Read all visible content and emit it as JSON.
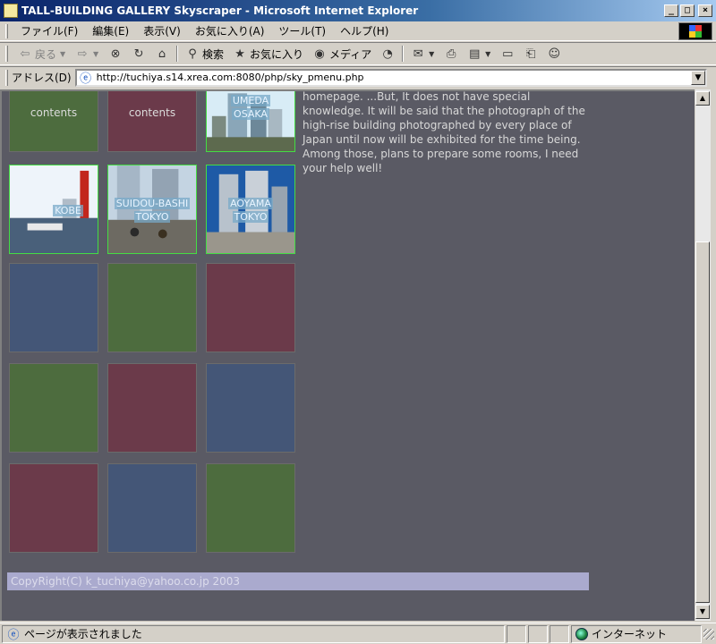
{
  "window": {
    "title": "TALL-BUILDING GALLERY Skyscraper - Microsoft Internet Explorer",
    "buttons": {
      "minimize": "_",
      "maximize": "□",
      "close": "×"
    }
  },
  "menubar": {
    "items": [
      "ファイル(F)",
      "編集(E)",
      "表示(V)",
      "お気に入り(A)",
      "ツール(T)",
      "ヘルプ(H)"
    ]
  },
  "toolbar": {
    "back": "戻る",
    "search": "検索",
    "favorites": "お気に入り",
    "media": "メディア"
  },
  "address": {
    "label": "アドレス(D)",
    "url": "http://tuchiya.s14.xrea.com:8080/php/sky_pmenu.php"
  },
  "page": {
    "tiles_row1": [
      "contents",
      "contents"
    ],
    "photos": [
      {
        "line1": "UMEDA",
        "line2": "OSAKA"
      },
      {
        "line1": "KOBE",
        "line2": ""
      },
      {
        "line1": "SUIDOU-BASHI",
        "line2": "TOKYO"
      },
      {
        "line1": "AOYAMA",
        "line2": "TOKYO"
      }
    ],
    "intro": "homepage. ...But, It does not have special knowledge. It will be said that the photograph of the high-rise building photographed by every place of Japan until now will be exhibited for the time being. Among those, plans to prepare some rooms, I need your help well!",
    "footer": "CopyRight(C) k_tuchiya@yahoo.co.jp 2003"
  },
  "statusbar": {
    "text": "ページが表示されました",
    "zone": "インターネット"
  },
  "colors": {
    "page_bg": "#5a5a64",
    "tile_green": "#4d6c3e",
    "tile_red": "#6b3a4a",
    "tile_blue": "#445677",
    "footer_bg": "#aaaace"
  }
}
